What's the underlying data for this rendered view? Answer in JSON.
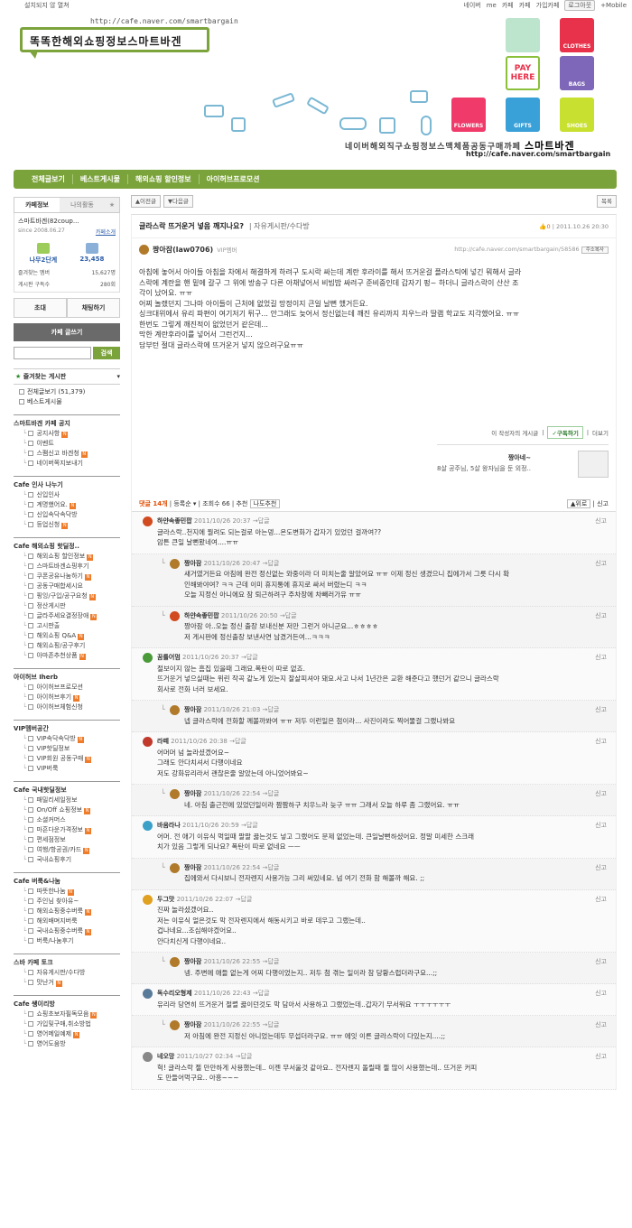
{
  "topbar": {
    "left_text": "설치되지 않 열쳐",
    "links": [
      "네이버",
      "me",
      "카페",
      "카페",
      "가입카페",
      "로그아웃",
      "+Mobile"
    ]
  },
  "header": {
    "cafe_url": "http://cafe.naver.com/smartbargain",
    "banner_title": "똑똑한해외쇼핑정보스마트바겐",
    "tiles": [
      "CLOTHES",
      "PAY HERE",
      "BAGS",
      "FLOWERS",
      "GIFTS",
      "SHOES"
    ],
    "tagline": "네이버해외직구쇼핑정보스맥체품공동구매까페",
    "tagline_brand": "스마트바겐",
    "tagline_url": "http://cafe.naver.com/smartbargain"
  },
  "nav": {
    "items": [
      "전체글보기",
      "베스트게시물",
      "해외쇼핑 할인정보",
      "아이허브프로모션"
    ]
  },
  "sidebar": {
    "tabs": [
      "카페정보",
      "나의활동"
    ],
    "cafe_name": "스마트바겐(82coup...",
    "since": "since 2008.06.27",
    "invite": "카페소개",
    "grade_label": "나무2단계",
    "members": "23,458",
    "rows": [
      {
        "label": "즐겨찾는 멤버",
        "value": "15,627명"
      },
      {
        "label": "게시판 구독수",
        "value": "280회"
      }
    ],
    "btn_invite": "초대",
    "btn_chat": "채팅하기",
    "write_btn": "카페 글쓰기",
    "search_btn": "검색",
    "fav_title": "즐겨찾는 게시판",
    "top_items": [
      "전체글보기 (51,379)",
      "베스트게시물"
    ],
    "groups": [
      {
        "title": "스마트바겐 카페 공지",
        "items": [
          "공지사항",
          "이벤트",
          "스팸신고 바겐청",
          "네이버쪽지보내기"
        ]
      },
      {
        "title": "Cafe 인사 나누기",
        "items": [
          "신입인사",
          "계명했어요.",
          "신입속닥속닥방",
          "등업신청"
        ]
      },
      {
        "title": "Cafe 해외쇼핑 핫딜정..",
        "items": [
          "해외쇼핑 할인정보",
          "스마트바겐쇼핑후기",
          "쿠폰공유나눔하기",
          "공동구매합세시요",
          "핑잉/구입/공구요청",
          "정산게시판",
          "글라주세요결정장애",
          "고시판출",
          "해외쇼핑 Q&A",
          "해외쇼핑/공구후기",
          "아마존추천상품"
        ]
      },
      {
        "title": "아이허브 Iherb",
        "items": [
          "아이허브프로모션",
          "아이허브후기",
          "아이허브체험신청"
        ]
      },
      {
        "title": "VIP멤버공간",
        "items": [
          "VIP속닥속닥방",
          "VIP핫딜정보",
          "VIP회원 공동구매",
          "VIP버룩"
        ]
      },
      {
        "title": "Cafe 국내핫딜정보",
        "items": [
          "패밀리세일정보",
          "On/Off 쇼핑정보",
          "소셜커머스",
          "마흔다운가격정보",
          "편세점정보",
          "여행/항공권/카드",
          "국내쇼핑후기"
        ]
      },
      {
        "title": "Cafe 버룩&나눔",
        "items": [
          "따뜻한나눔",
          "주인님 찾아유~",
          "해외쇼핑중수버룩",
          "해외배며지버룩",
          "국내쇼핑중수버룩",
          "버룩/나눔후기"
        ]
      },
      {
        "title": "스바 카페 토크",
        "items": [
          "자유게시판/수다방",
          "맛난거"
        ]
      },
      {
        "title": "Cafe 쌩이리방",
        "items": [
          "쇼핑초보자필독모음",
          "가입및구매,취소방법",
          "영어메일예제",
          "영어도움방"
        ]
      }
    ]
  },
  "main": {
    "prev_btn": "이전글",
    "next_btn": "다음글",
    "list_btn": "목록",
    "post": {
      "title": "글라스락 뜨거운거 넣음 깨지나요?",
      "category": "자유게시판/수다방",
      "likes": "0",
      "date": "2011.10.26 20:30",
      "copy_btn": "주소복사",
      "author": "짱아잠(law0706)",
      "author_grade": "VIP멤버",
      "url": "http://cafe.naver.com/smartbargain/58586",
      "body": [
        "아침에 놓어서 아이들 아침을 차에서 해결하게 하려구 도시락 싸는데 계란 후라이를 해서 뜨거운걸 플라스틱에 넣긴 뭐해서 글라",
        "스락에 계란을 핸 밑에 갈구 그 위에 방송구 다른 아채넣어서 비빔밥 싸려구 준비중인데 갑자기 펑~ 하더니 글라스락이 산산 조",
        "각이 났어요. ㅠㅠ",
        "어찌 놀랬던지 그나마 아이들이 근처에 없었길 망정이지 큰일 날뻔 했거든요.",
        "싱크대위에서 유리 파편이 여기저기 튀구... 안그래도 늦어서 정신없는데 깨진 유리까지 치우느라 딸램 학교도 지각했어요. ㅠㅠ",
        "한번도 그렇게 깨진적이 없었던거 같은데...",
        "막한 계란후라이를 넣어서 그런건지...",
        "담부턴 절대 글라스락에 뜨거운거 넣지 않으려구요ㅠㅠ"
      ],
      "subscribe_text": "이 작성자의 게시글",
      "subscribe_btn": "구독하기",
      "more": "더보기",
      "writer_name": "짱아네~",
      "writer_desc": "8살 공주님, 5살 왕자님을 둔 외정.."
    },
    "comment_bar": {
      "count": "댓글 14개",
      "order": "등록순",
      "views": "조회수 66",
      "recommend": "추천",
      "nido": "나도추천",
      "top": "위로",
      "report": "신고"
    },
    "comments": [
      {
        "name": "하얀속좋민팝",
        "date": "2011/10/26 20:37",
        "reply": "답글",
        "report": "신고",
        "text": [
          "글라스락..천지에 뭘려도 되는걸로 아는뎅...온도변화가 갑자기 있었던 걸까여??",
          "암튼 큰일 날뻔봤네여....ㅠㅠ"
        ],
        "reply_level": false,
        "color": "#d24a1f"
      },
      {
        "name": "짱아잠",
        "date": "2011/10/26 20:47",
        "reply": "답글",
        "report": "신고",
        "text": [
          "새거였거든요 아침에 완전 정신없는 와중이라 더 미치는줄 알았어요 ㅠㅠ 이제 정신 생겼으니 집에가서 그릇 다시 확",
          "인해봐야여? ㅋㅋ 근데 이미 휴지통에 휴지로 싸서 버렸는디 ㅋㅋ",
          "오늘 지정신 아니에요 잠 퇴근하려구 주차장에 차빼러가유 ㅠㅠ"
        ],
        "reply_level": true,
        "color": "#b07a2a"
      },
      {
        "name": "하얀속좋민팝",
        "date": "2011/10/26 20:50",
        "reply": "답글",
        "report": "신고",
        "text": [
          "짱아잠 아..오늘 정신 출장 보내신분 저만 그런거 아니군요...ㅎㅎㅎㅎ",
          "저 게시판에 정신출장 보낸사연 남겼거든여...ㅋㅋㅋ"
        ],
        "reply_level": true,
        "color": "#d24a1f"
      },
      {
        "name": "꿈틀어멈",
        "date": "2011/10/26 20:37",
        "reply": "답글",
        "report": "신고",
        "text": [
          "절보이지 않는 흠집 있을때 그래요.폭탄이 따로 없죠.",
          "뜨거운거 넣으실때는 위린 작곡 같노게 있는지 잘살피셔야 돼요.사고 나서 1년간은 교환 해준다고 했던거 같으니 글라스락",
          "회사로 전화 너러 보세요."
        ],
        "reply_level": false,
        "color": "#4a9a3a"
      },
      {
        "name": "짱아잠",
        "date": "2011/10/26 21:03",
        "reply": "답글",
        "report": "신고",
        "text": [
          "넵 글라스락에 전화할 께볼까봐여 ㅠㅠ 저두 이런일은 첨이라... 사진이라도 찍어뚤걸 그랬나봐요"
        ],
        "reply_level": true,
        "color": "#b07a2a"
      },
      {
        "name": "라떼",
        "date": "2011/10/26 20:38",
        "reply": "답글",
        "report": "신고",
        "text": [
          "어머머 넘 놀라셨겠어요~",
          "그래도 안다치셔서 다행이네요",
          "저도 강화유리라서 괜찮은줄 알았는데 아니었어봐요~"
        ],
        "reply_level": false,
        "color": "#c0392b"
      },
      {
        "name": "짱아잠",
        "date": "2011/10/26 22:54",
        "reply": "답글",
        "report": "신고",
        "text": [
          "네. 아침 출근전에 있었던일이라 짬짬하구 치우느라 늦구 ㅠㅠ 그래서 오늘 하루 좀 그랬어요. ㅠㅠ"
        ],
        "reply_level": true,
        "color": "#b07a2a"
      },
      {
        "name": "바움라나",
        "date": "2011/10/26 20:59",
        "reply": "답글",
        "report": "신고",
        "text": [
          "어머. 전 애기 이유식 먹일때 팔팔 끓는것도 넣고 그랬어도 문제 없었는데. 큰일날뻔하셨어요. 정말 미세한 스크래",
          "치가 있음 그렇게 되나요? 폭탄이 따로 없네요 ㅡㅡ"
        ],
        "reply_level": false,
        "color": "#3aa0c8"
      },
      {
        "name": "짱아잠",
        "date": "2011/10/26 22:54",
        "reply": "답글",
        "report": "신고",
        "text": [
          "집에와서 다시보니 전자렌지 사용가능 그리 써있네요. 넘 여기 전화 함 해볼까 해요. ;;"
        ],
        "reply_level": true,
        "color": "#b07a2a"
      },
      {
        "name": "두그맛",
        "date": "2011/10/26 22:07",
        "reply": "답글",
        "report": "신고",
        "text": [
          "진짜 놀라셨겠어요..",
          "저는 이유식 얼은것도 막 전자렌지에서 해동시키고 바로 데우고 그랬는데..",
          "겁나네요...조심해야겠어요..",
          "안다치신게 다행이네요.."
        ],
        "reply_level": false,
        "color": "#e0a020"
      },
      {
        "name": "짱아잠",
        "date": "2011/10/26 22:55",
        "reply": "답글",
        "report": "신고",
        "text": [
          "넹. 주변에 애들 없는게 어찌 다행이었는지.. 저두 첨 겪는 일이라 참 당황스럽더라구요...;;"
        ],
        "reply_level": true,
        "color": "#b07a2a"
      },
      {
        "name": "독수리오형제",
        "date": "2011/10/26 22:43",
        "reply": "답글",
        "report": "신고",
        "text": [
          "유리라 당연히 뜨거운거 절렬 끓이던것도 막 담아서 사용하고 그랬었는데..갑자기 무서워요 ㅜㅜㅜㅜㅜㅜ"
        ],
        "reply_level": false,
        "color": "#5a7a9a"
      },
      {
        "name": "짱아잠",
        "date": "2011/10/26 22:55",
        "reply": "답글",
        "report": "신고",
        "text": [
          "저 아침에 완전 지정신 아니었는데두 무섭더라구요. ㅠㅠ 에잇 이른 글라스락이 다있는지....;;"
        ],
        "reply_level": true,
        "color": "#b07a2a"
      },
      {
        "name": "네오망",
        "date": "2011/10/27 02:34",
        "reply": "답글",
        "report": "신고",
        "text": [
          "헉! 글라스락 젤 만만하게 사용했는데.. 이젠 무서울것 같아요.. 전자렌지 돌릴때 젤 많이 사용했는데.. 뜨거운 커피",
          "도 만들어먹구요.. 아흥~~~"
        ],
        "reply_level": false,
        "color": "#888888"
      }
    ]
  },
  "colors": {
    "nav_green": "#7ba33b",
    "accent_orange": "#ef7c2a"
  }
}
